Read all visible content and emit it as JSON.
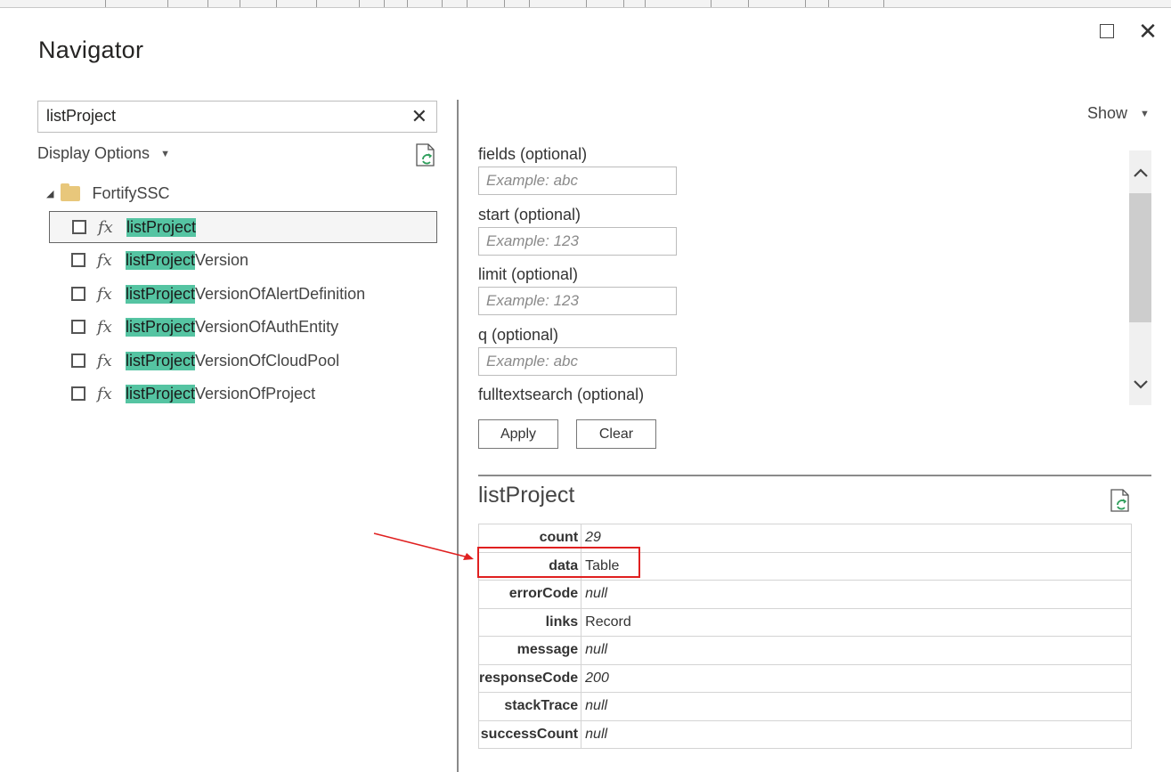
{
  "dialog": {
    "title": "Navigator",
    "maximize_glyph": "□",
    "close_glyph": "✕"
  },
  "left_pane": {
    "search": {
      "value": "listProject",
      "clear_glyph": "✕"
    },
    "display_options_label": "Display Options",
    "tree": {
      "root_label": "FortifySSC",
      "items": [
        {
          "match": "listProject",
          "rest": "",
          "selected": true
        },
        {
          "match": "listProject",
          "rest": "Version",
          "selected": false
        },
        {
          "match": "listProject",
          "rest": "VersionOfAlertDefinition",
          "selected": false
        },
        {
          "match": "listProject",
          "rest": "VersionOfAuthEntity",
          "selected": false
        },
        {
          "match": "listProject",
          "rest": "VersionOfCloudPool",
          "selected": false
        },
        {
          "match": "listProject",
          "rest": "VersionOfProject",
          "selected": false
        }
      ],
      "function_glyph": "fx"
    }
  },
  "right_pane": {
    "show_label": "Show",
    "parameters": [
      {
        "label": "fields (optional)",
        "placeholder": "Example: abc"
      },
      {
        "label": "start (optional)",
        "placeholder": "Example: 123"
      },
      {
        "label": "limit (optional)",
        "placeholder": "Example: 123"
      },
      {
        "label": "q (optional)",
        "placeholder": "Example: abc"
      },
      {
        "label": "fulltextsearch (optional)"
      }
    ],
    "apply_label": "Apply",
    "clear_label": "Clear",
    "preview": {
      "title": "listProject",
      "record": [
        {
          "key": "count",
          "value": "29",
          "italic": true
        },
        {
          "key": "data",
          "value": "Table",
          "italic": false
        },
        {
          "key": "errorCode",
          "value": "null",
          "italic": true
        },
        {
          "key": "links",
          "value": "Record",
          "italic": false
        },
        {
          "key": "message",
          "value": "null",
          "italic": true
        },
        {
          "key": "responseCode",
          "value": "200",
          "italic": true
        },
        {
          "key": "stackTrace",
          "value": "null",
          "italic": true
        },
        {
          "key": "successCount",
          "value": "null",
          "italic": true
        }
      ]
    }
  },
  "annotation": {
    "color": "#e02020"
  },
  "colors": {
    "highlight": "#55c4a2",
    "folder": "#e8c77b"
  },
  "icons": [
    "close-icon",
    "maximize-icon",
    "folder-icon",
    "function-icon",
    "refresh-icon",
    "caret-down-icon",
    "chevron-up-icon",
    "chevron-down-icon"
  ]
}
